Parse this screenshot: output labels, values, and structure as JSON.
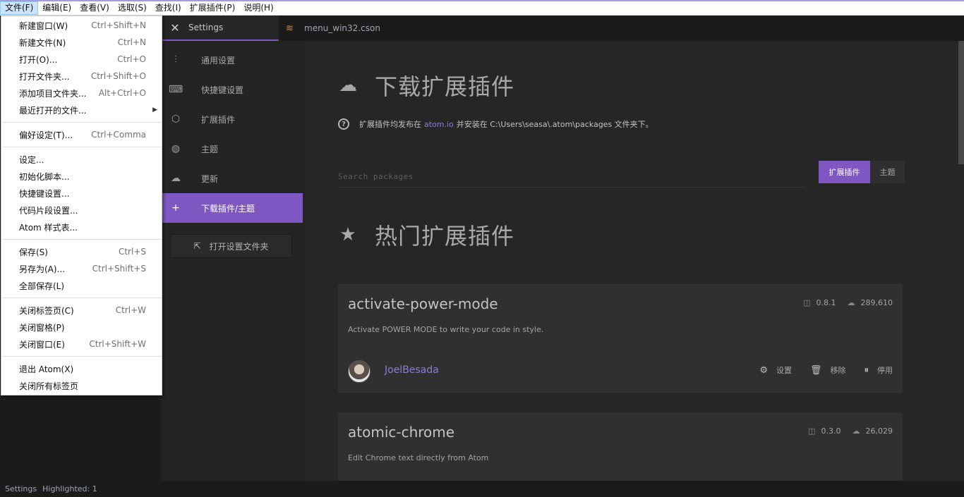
{
  "menubar": {
    "items": [
      "文件(F)",
      "编辑(E)",
      "查看(V)",
      "选取(S)",
      "查找(I)",
      "扩展插件(P)",
      "说明(H)"
    ]
  },
  "tabs": {
    "settings": "Settings",
    "file": "menu_win32.cson"
  },
  "settings_nav": {
    "items": [
      {
        "label": "通用设置",
        "icon": "sliders-icon"
      },
      {
        "label": "快捷键设置",
        "icon": "keyboard-icon"
      },
      {
        "label": "扩展插件",
        "icon": "package-icon"
      },
      {
        "label": "主题",
        "icon": "paintcan-icon"
      },
      {
        "label": "更新",
        "icon": "cloud-download-icon"
      },
      {
        "label": "下载插件/主题",
        "icon": "plus-icon"
      }
    ],
    "open_folder": "打开设置文件夹"
  },
  "main": {
    "install_title": "下载扩展插件",
    "info": {
      "prefix": "扩展插件均发布在",
      "link": "atom.io",
      "suffix": "并安装在 C:\\Users\\seasa\\.atom\\packages 文件夹下。"
    },
    "search_placeholder": "Search packages",
    "toggle": {
      "packages": "扩展插件",
      "themes": "主题"
    },
    "featured_title": "热门扩展插件",
    "packages": [
      {
        "name": "activate-power-mode",
        "description": "Activate POWER MODE to write your code in style.",
        "version": "0.8.1",
        "downloads": "289,610",
        "author": "JoelBesada",
        "actions": {
          "settings": "设置",
          "uninstall": "移除",
          "disable": "停用"
        }
      },
      {
        "name": "atomic-chrome",
        "description": "Edit Chrome text directly from Atom",
        "version": "0.3.0",
        "downloads": "26,029"
      }
    ]
  },
  "statusbar": {
    "left": "Settings",
    "highlighted": "Highlighted: 1"
  },
  "file_menu": {
    "groups": [
      [
        {
          "label": "新建窗口(W)",
          "shortcut": "Ctrl+Shift+N"
        },
        {
          "label": "新建文件(N)",
          "shortcut": "Ctrl+N"
        },
        {
          "label": "打开(O)...",
          "shortcut": "Ctrl+O"
        },
        {
          "label": "打开文件夹...",
          "shortcut": "Ctrl+Shift+O"
        },
        {
          "label": "添加项目文件夹...",
          "shortcut": "Alt+Ctrl+O"
        },
        {
          "label": "最近打开的文件...",
          "shortcut": ""
        }
      ],
      [
        {
          "label": "偏好设定(T)...",
          "shortcut": "Ctrl+Comma"
        }
      ],
      [
        {
          "label": "设定...",
          "shortcut": ""
        },
        {
          "label": "初始化脚本...",
          "shortcut": ""
        },
        {
          "label": "快捷键设置...",
          "shortcut": ""
        },
        {
          "label": "代码片段设置...",
          "shortcut": ""
        },
        {
          "label": "Atom 样式表...",
          "shortcut": ""
        }
      ],
      [
        {
          "label": "保存(S)",
          "shortcut": "Ctrl+S"
        },
        {
          "label": "另存为(A)...",
          "shortcut": "Ctrl+Shift+S"
        },
        {
          "label": "全部保存(L)",
          "shortcut": ""
        }
      ],
      [
        {
          "label": "关闭标签页(C)",
          "shortcut": "Ctrl+W"
        },
        {
          "label": "关闭窗格(P)",
          "shortcut": ""
        },
        {
          "label": "关闭窗口(E)",
          "shortcut": "Ctrl+Shift+W"
        }
      ],
      [
        {
          "label": "退出 Atom(X)",
          "shortcut": ""
        },
        {
          "label": "关闭所有标签页",
          "shortcut": ""
        }
      ]
    ]
  },
  "colors": {
    "accent": "#7e57c2",
    "link": "#8e7cd6",
    "background": "#262626"
  }
}
